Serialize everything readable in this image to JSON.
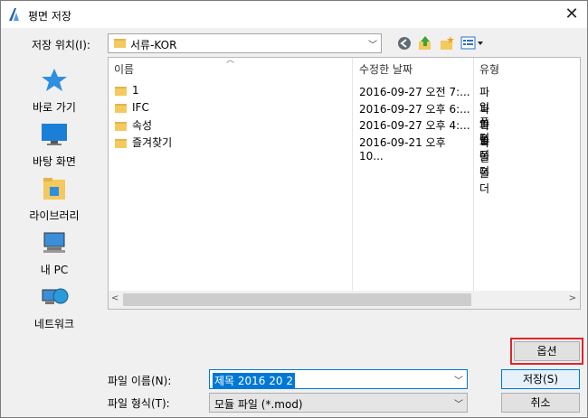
{
  "window": {
    "title": "평면 저장",
    "close_glyph": "✕"
  },
  "location": {
    "label": "저장 위치(I):",
    "value": "서류-KOR"
  },
  "places": [
    {
      "label": "바로 가기",
      "icon": "star-icon"
    },
    {
      "label": "바탕 화면",
      "icon": "desktop-icon"
    },
    {
      "label": "라이브러리",
      "icon": "library-icon"
    },
    {
      "label": "내 PC",
      "icon": "computer-icon"
    },
    {
      "label": "네트워크",
      "icon": "network-icon"
    }
  ],
  "columns": {
    "name": "이름",
    "date": "수정한 날짜",
    "type": "유형"
  },
  "files": [
    {
      "name": "1",
      "date": "2016-09-27 오전 7:...",
      "type": "파일 폴더"
    },
    {
      "name": "IFC",
      "date": "2016-09-27 오후 6:...",
      "type": "파일 폴더"
    },
    {
      "name": "속성",
      "date": "2016-09-27 오후 4:...",
      "type": "파일 폴더"
    },
    {
      "name": "즐겨찾기",
      "date": "2016-09-21 오후 10...",
      "type": "파일 폴더"
    }
  ],
  "filename": {
    "label": "파일 이름(N):",
    "value": "제목 2016 20 2"
  },
  "filetype": {
    "label": "파일 형식(T):",
    "value": "모듈 파일 (*.mod)"
  },
  "buttons": {
    "options": "옵션",
    "save": "저장(S)",
    "cancel": "취소"
  }
}
